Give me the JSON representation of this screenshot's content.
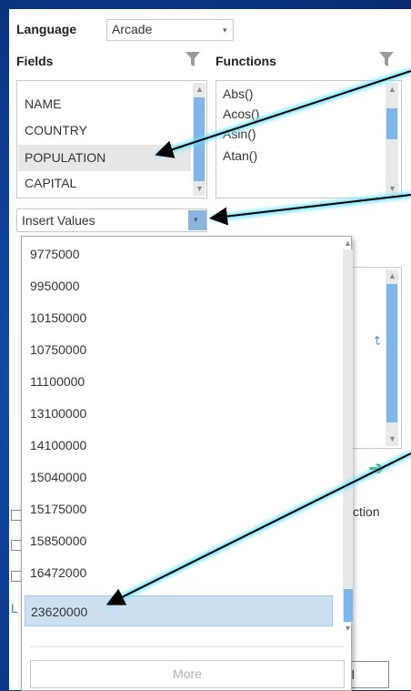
{
  "language": {
    "label": "Language",
    "value": "Arcade"
  },
  "fields": {
    "title": "Fields",
    "items": [
      "NAME",
      "COUNTRY",
      "POPULATION",
      "CAPITAL"
    ],
    "selected_index": 2
  },
  "functions": {
    "title": "Functions",
    "items": [
      "Abs()",
      "Acos()",
      "Asin()",
      "Atan()"
    ]
  },
  "insert_values": {
    "label": "Insert Values",
    "options": [
      "9775000",
      "9950000",
      "10150000",
      "10750000",
      "11100000",
      "13100000",
      "14100000",
      "15040000",
      "15175000",
      "15850000",
      "16472000",
      "23620000"
    ],
    "selected_index": 11,
    "more_label": "More"
  },
  "background_partial": {
    "ction_text": "ction",
    "el_text": "el",
    "l_text": "L"
  },
  "colors": {
    "accent_thumb": "#7fb6e8",
    "selection": "#cde0f1",
    "callout_glow": "#69e3ff",
    "green_arrow": "#2e9e4f"
  }
}
